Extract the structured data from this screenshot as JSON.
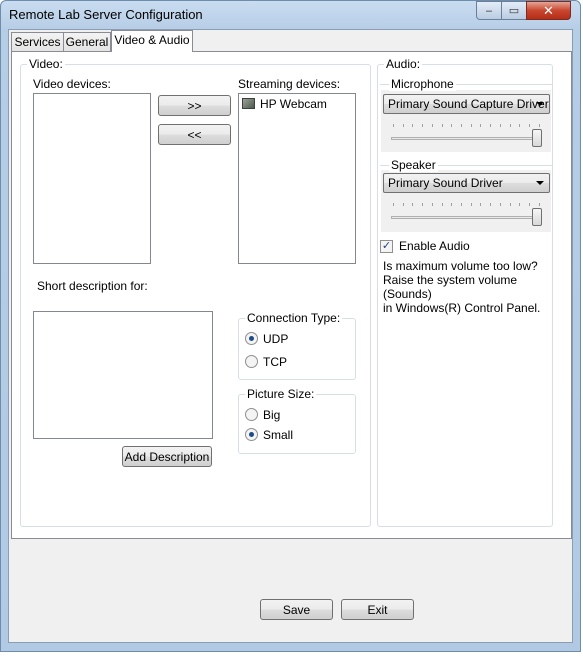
{
  "window": {
    "title": "Remote Lab Server Configuration",
    "minimize_glyph": "‒",
    "maximize_glyph": "▭",
    "close_glyph": "✕"
  },
  "tabs": [
    {
      "label": "Services"
    },
    {
      "label": "General"
    },
    {
      "label": "Video & Audio"
    }
  ],
  "video": {
    "group_label": "Video:",
    "video_devices_label": "Video devices:",
    "streaming_devices_label": "Streaming devices:",
    "video_devices": [],
    "streaming_devices": [
      {
        "label": "HP Webcam",
        "icon": "webcam-icon"
      }
    ],
    "add_button": ">>",
    "remove_button": "<<",
    "short_description_label": "Short description for:",
    "description_value": "",
    "add_description_button": "Add Description",
    "connection_type": {
      "label": "Connection Type:",
      "options": [
        "UDP",
        "TCP"
      ],
      "selected": "UDP"
    },
    "picture_size": {
      "label": "Picture Size:",
      "options": [
        "Big",
        "Small"
      ],
      "selected": "Small"
    }
  },
  "audio": {
    "group_label": "Audio:",
    "microphone_label": "Microphone",
    "microphone_driver": "Primary Sound Capture Driver",
    "microphone_volume": 1.0,
    "speaker_label": "Speaker",
    "speaker_driver": "Primary Sound Driver",
    "speaker_volume": 1.0,
    "enable_audio_label": "Enable Audio",
    "enable_audio_checked": true,
    "hint_lines": [
      "Is maximum volume too low?",
      "Raise the system volume (Sounds)",
      "in Windows(R) Control Panel."
    ]
  },
  "footer": {
    "save_button": "Save",
    "exit_button": "Exit"
  }
}
